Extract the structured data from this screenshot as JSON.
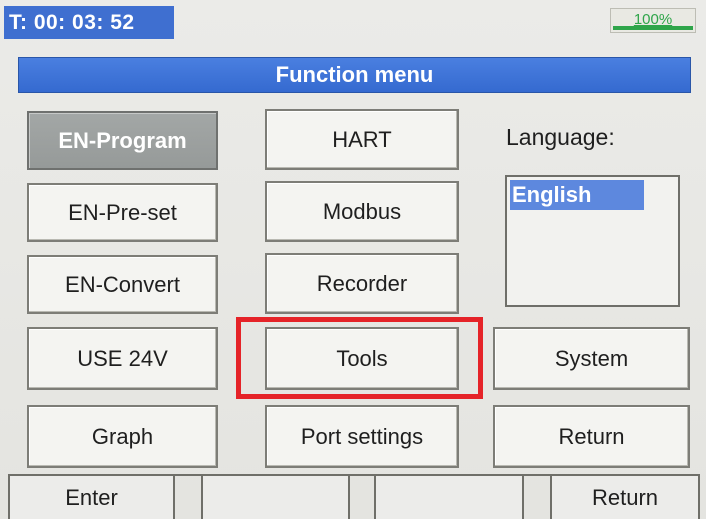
{
  "status": {
    "timer": "T: 00: 03: 52",
    "battery_text": "100%",
    "battery_level": 1.0
  },
  "title": "Function menu",
  "buttons": {
    "en_program": "EN-Program",
    "en_preset": "EN-Pre-set",
    "en_convert": "EN-Convert",
    "use_24v": "USE 24V",
    "graph": "Graph",
    "hart": "HART",
    "modbus": "Modbus",
    "recorder": "Recorder",
    "tools": "Tools",
    "port_settings": "Port settings",
    "system": "System",
    "return": "Return"
  },
  "language": {
    "label": "Language:",
    "options": [
      "English"
    ],
    "selected": "English"
  },
  "softkeys": {
    "enter": "Enter",
    "blank1": "",
    "blank2": "",
    "return": "Return"
  },
  "colors": {
    "title_bar": "#356ad0",
    "timer_bg": "#3f6fd0",
    "selected_language": "#5d88de",
    "active_button": "#9a9e9d",
    "highlight_box": "#e52328",
    "battery": "#2fa54a"
  }
}
